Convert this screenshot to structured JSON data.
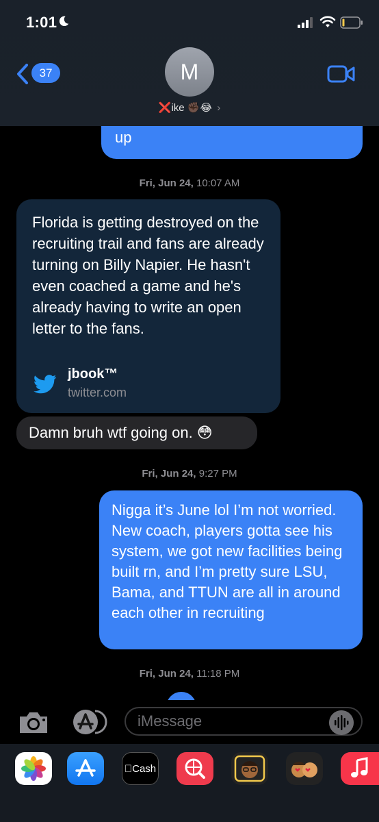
{
  "status_bar": {
    "time": "1:01"
  },
  "header": {
    "back_count": "37",
    "avatar_initial": "M",
    "contact_name": "ike",
    "contact_name_prefix": "❌",
    "contact_name_emoji": "✊🏿😂",
    "chevron": "›"
  },
  "messages": {
    "sent1_text": "up",
    "ts1": {
      "day": "Fri, Jun 24,",
      "time": "10:07 AM"
    },
    "card": {
      "text": "Florida is getting destroyed on the recruiting trail and fans are already turning on Billy Napier. He hasn't even coached a game and he's already having to write an open letter to the fans.",
      "title": "jbook™",
      "domain": "twitter.com"
    },
    "recv2_text": "Damn bruh wtf going on. 😳",
    "ts2": {
      "day": "Fri, Jun 24,",
      "time": "9:27 PM"
    },
    "sent3_text": "Nigga it’s June lol I’m not worried. New coach, players gotta see his system, we got new facilities being built rn, and I’m pretty sure LSU, Bama, and TTUN are all in around each other in recruiting",
    "ts3": {
      "day": "Fri, Jun 24,",
      "time": "11:18 PM"
    }
  },
  "input": {
    "placeholder": "iMessage"
  },
  "drawer": {
    "cash_label": "Cash",
    "cash_prefix": ""
  },
  "colors": {
    "sent_bubble": "#3b82f6",
    "received_bubble": "#262629",
    "link_card": "#13263a",
    "header_bg": "#1b222b"
  }
}
